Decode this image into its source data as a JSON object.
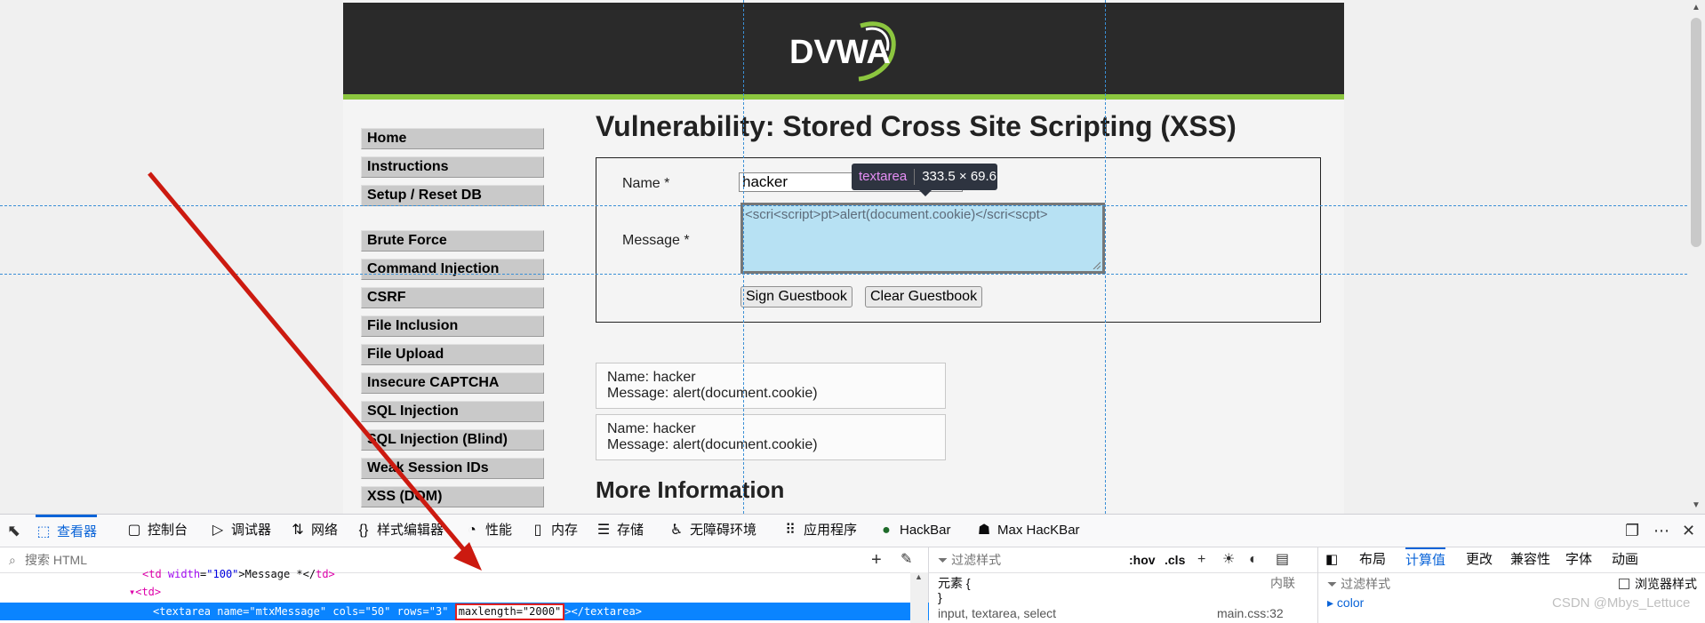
{
  "page": {
    "logo_text": "DVWA",
    "menu_group1": [
      "Home",
      "Instructions",
      "Setup / Reset DB"
    ],
    "menu_group2": [
      "Brute Force",
      "Command Injection",
      "CSRF",
      "File Inclusion",
      "File Upload",
      "Insecure CAPTCHA",
      "SQL Injection",
      "SQL Injection (Blind)",
      "Weak Session IDs",
      "XSS (DOM)"
    ],
    "title": "Vulnerability: Stored Cross Site Scripting (XSS)",
    "form": {
      "name_label": "Name *",
      "name_value": "hacker",
      "message_label": "Message *",
      "message_value": "<scri<script>pt>alert(document.cookie)</scri<scpt>",
      "sign_button": "Sign Guestbook",
      "clear_button": "Clear Guestbook"
    },
    "entries": [
      {
        "name": "Name: hacker",
        "message": "Message: alert(document.cookie)"
      },
      {
        "name": "Name: hacker",
        "message": "Message: alert(document.cookie)"
      }
    ],
    "more_info": "More Information"
  },
  "inspector_tooltip": {
    "tag": "textarea",
    "dims": "333.5 × 69.6"
  },
  "devtools": {
    "tabs": [
      {
        "label": "查看器",
        "icon": "inspector-icon",
        "glyph": "⬚"
      },
      {
        "label": "控制台",
        "icon": "console-icon",
        "glyph": "▢"
      },
      {
        "label": "调试器",
        "icon": "debugger-icon",
        "glyph": "▷"
      },
      {
        "label": "网络",
        "icon": "network-icon",
        "glyph": "⇅"
      },
      {
        "label": "样式编辑器",
        "icon": "style-editor-icon",
        "glyph": "{}"
      },
      {
        "label": "性能",
        "icon": "performance-icon",
        "glyph": "◔"
      },
      {
        "label": "内存",
        "icon": "memory-icon",
        "glyph": "▯"
      },
      {
        "label": "存储",
        "icon": "storage-icon",
        "glyph": "☰"
      },
      {
        "label": "无障碍环境",
        "icon": "accessibility-icon",
        "glyph": "♿"
      },
      {
        "label": "应用程序",
        "icon": "application-icon",
        "glyph": "⠿"
      },
      {
        "label": "HackBar",
        "icon": "hackbar-icon",
        "glyph": "●"
      },
      {
        "label": "Max HacKBar",
        "icon": "max-hackbar-icon",
        "glyph": "☗"
      }
    ],
    "search_placeholder": "搜索 HTML",
    "code_lines": {
      "line1_tag": "<td",
      "line1_attr": "width",
      "line1_val": "\"100\"",
      "line1_text": ">Message *</",
      "line1_close": "td>",
      "line2": "▾<td>",
      "line3_prefix": "<textarea",
      "line3_name_attr": "name",
      "line3_name_val": "\"mtxMessage\"",
      "line3_cols_attr": "cols",
      "line3_cols_val": "\"50\"",
      "line3_rows_attr": "rows",
      "line3_rows_val": "\"3\"",
      "line3_maxlen": "maxlength=\"2000\"",
      "line3_suffix": "></textarea>"
    },
    "rules_filter": "过滤样式",
    "hov": ":hov",
    "cls": ".cls",
    "rules": {
      "element": "元素 {",
      "close": "}",
      "inline": "内联",
      "next_rule": "input, textarea, select",
      "next_src": "main.css:32"
    },
    "computed_tabs": [
      "布局",
      "计算值",
      "更改",
      "兼容性",
      "字体",
      "动画"
    ],
    "computed_active": "计算值",
    "computed_filter": "过滤样式",
    "browser_styles": "浏览器样式",
    "first_prop": "color"
  },
  "watermark": "CSDN @Mbys_Lettuce"
}
